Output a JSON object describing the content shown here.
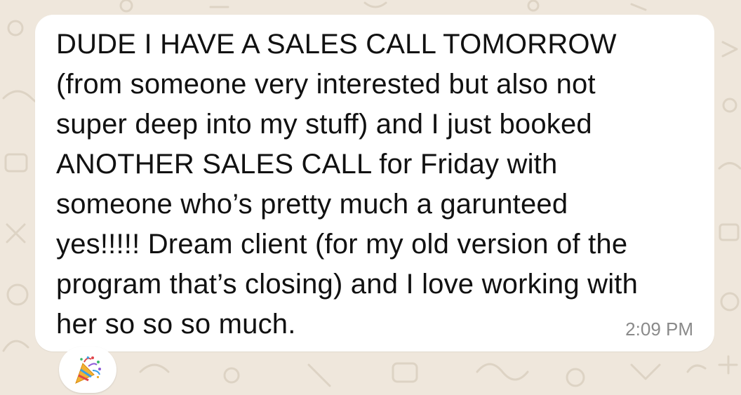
{
  "message": {
    "text": "DUDE I HAVE A SALES CALL TOMORROW\n(from someone very interested but also not\nsuper deep into my stuff) and I just booked\nANOTHER SALES CALL for Friday with\nsomeone who’s pretty much a garunteed\nyes!!!!! Dream client (for my old version of the\nprogram that’s closing) and I love working with\nher so so so much.",
    "timestamp": "2:09 PM",
    "bubble_color": "#ffffff"
  },
  "reaction": {
    "icon": "party-popper-icon"
  },
  "chat_background": "#efe7dc"
}
